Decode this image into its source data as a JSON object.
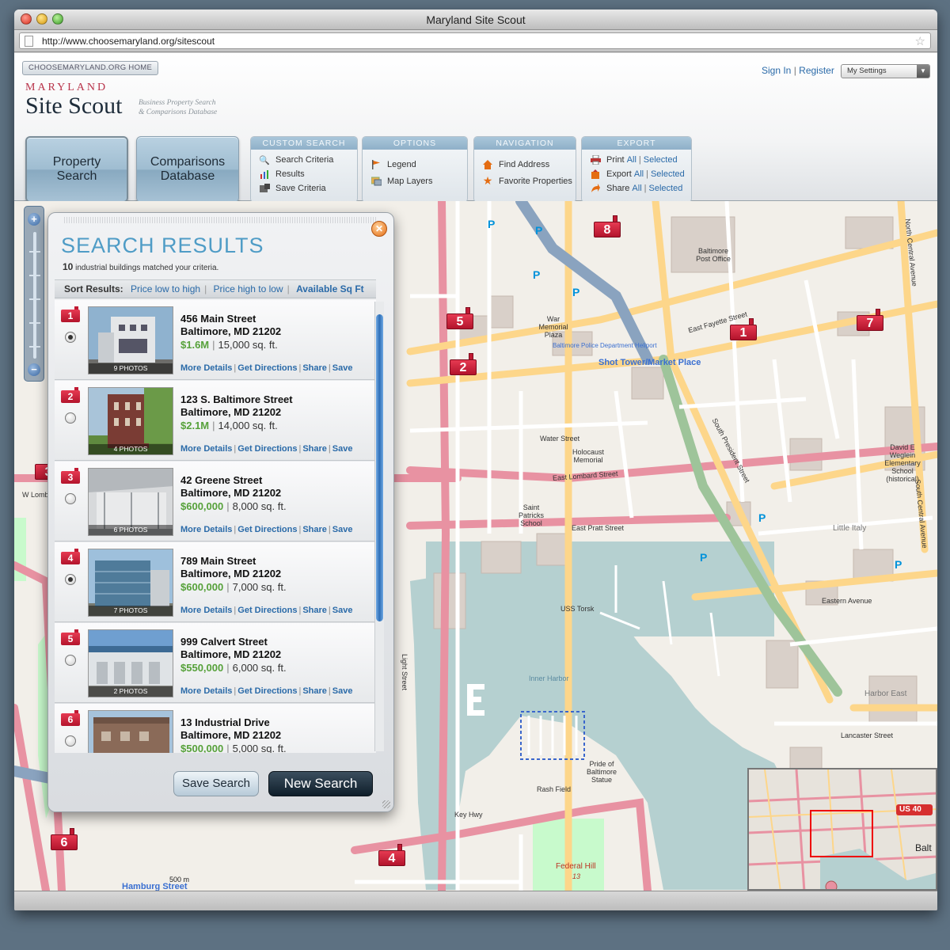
{
  "window": {
    "title": "Maryland Site Scout"
  },
  "browser": {
    "url": "http://www.choosemaryland.org/sitescout"
  },
  "header": {
    "home_link": "CHOOSEMARYLAND.ORG HOME",
    "brand_small": "MARYLAND",
    "brand_big": "Site Scout",
    "tagline_1": "Business Property Search",
    "tagline_2": "& Comparisons Database",
    "sign_in": "Sign In",
    "register": "Register",
    "settings": "My Settings"
  },
  "nav": {
    "property_search_1": "Property",
    "property_search_2": "Search",
    "comparisons_1": "Comparisons",
    "comparisons_2": "Database"
  },
  "panels": {
    "custom_search": {
      "title": "CUSTOM SEARCH",
      "items": [
        "Search Criteria",
        "Results",
        "Save Criteria"
      ]
    },
    "options": {
      "title": "OPTIONS",
      "items": [
        "Legend",
        "Map Layers"
      ]
    },
    "navigation": {
      "title": "NAVIGATION",
      "items": [
        "Find Address",
        "Favorite Properties"
      ]
    },
    "export": {
      "title": "EXPORT",
      "items": [
        "Print",
        "Export",
        "Share"
      ],
      "all": "All",
      "selected": "Selected"
    }
  },
  "map": {
    "labels": {
      "shot_tower": "Shot Tower/Market Place",
      "heliport": "Baltimore Police Department Heliport",
      "inner_harbor": "Inner Harbor",
      "uss_torsk": "USS Torsk",
      "little_italy": "Little Italy",
      "harbor_east": "Harbor East",
      "post_office": "Baltimore Post Office",
      "federal_hill": "Federal Hill",
      "federal_hill_num": "13",
      "rash_field": "Rash Field",
      "pride": "Pride of Baltimore Statue",
      "hamburg": "Hamburg Street",
      "e_fayette": "East Fayette Street",
      "e_lombard": "East Lombard Street",
      "e_pratt": "East Pratt Street",
      "eastern_ave": "Eastern Avenue",
      "key_hwy": "Key Hwy",
      "s_president": "South President Street",
      "light_st": "Light Street",
      "s_central": "South Central Avenue",
      "n_central": "North Central Avenue",
      "water_st": "Water Street",
      "lancaster": "Lancaster Street",
      "w_lombard": "W Lombard",
      "holocaust": "Holocaust Memorial",
      "saint_patricks": "Saint Patricks School",
      "war_memorial": "War Memorial Plaza",
      "david_weglein": "David E Weglein Elementary School (historical)",
      "us40": "US 40",
      "balt": "Balt"
    },
    "markers": [
      "1",
      "2",
      "3",
      "4",
      "5",
      "6",
      "7",
      "8"
    ],
    "scale": "500 m"
  },
  "results": {
    "title": "SEARCH RESULTS",
    "count": "10",
    "count_suffix": "industrial buildings matched your criteria.",
    "sort_label": "Sort Results:",
    "sort_options": [
      "Price low to high",
      "Price high to low",
      "Available Sq Ft"
    ],
    "link_labels": [
      "More Details",
      "Get Directions",
      "Share",
      "Save"
    ],
    "items": [
      {
        "num": "1",
        "photos": "9 PHOTOS",
        "addr1": "456 Main Street",
        "addr2": "Baltimore, MD 21202",
        "price": "$1.6M",
        "sqft": "15,000 sq. ft."
      },
      {
        "num": "2",
        "photos": "4 PHOTOS",
        "addr1": "123 S. Baltimore Street",
        "addr2": "Baltimore, MD 21202",
        "price": "$2.1M",
        "sqft": "14,000 sq. ft."
      },
      {
        "num": "3",
        "photos": "6 PHOTOS",
        "addr1": "42 Greene Street",
        "addr2": "Baltimore, MD 21202",
        "price": "$600,000",
        "sqft": "8,000 sq. ft."
      },
      {
        "num": "4",
        "photos": "7 PHOTOS",
        "addr1": "789 Main Street",
        "addr2": "Baltimore, MD 21202",
        "price": "$600,000",
        "sqft": "7,000 sq. ft."
      },
      {
        "num": "5",
        "photos": "2 PHOTOS",
        "addr1": "999 Calvert Street",
        "addr2": "Baltimore, MD 21202",
        "price": "$550,000",
        "sqft": "6,000 sq. ft."
      },
      {
        "num": "6",
        "photos": "",
        "addr1": "13 Industrial Drive",
        "addr2": "Baltimore, MD 21202",
        "price": "$500,000",
        "sqft": "5,000 sq. ft."
      }
    ],
    "save_search": "Save Search",
    "new_search": "New Search"
  },
  "colors": {
    "accent": "#4f9cc6",
    "price": "#56a13a",
    "marker": "#d0213b",
    "link": "#2a6aa8"
  }
}
